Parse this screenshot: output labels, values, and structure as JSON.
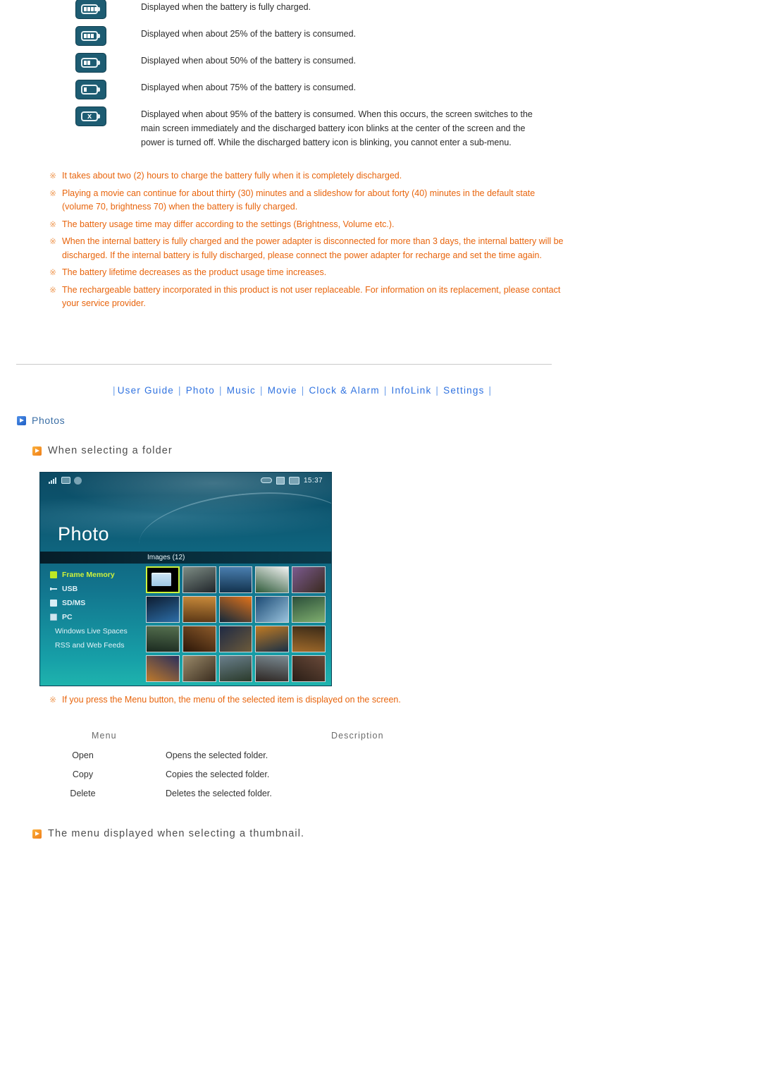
{
  "battery_table": {
    "rows": [
      {
        "icon": "battery-full-icon",
        "segments": 4,
        "desc": "Displayed when the battery is fully charged."
      },
      {
        "icon": "battery-75-icon",
        "segments": 3,
        "desc": "Displayed when about 25% of the battery is consumed."
      },
      {
        "icon": "battery-50-icon",
        "segments": 2,
        "desc": "Displayed when about 50% of the battery is consumed."
      },
      {
        "icon": "battery-25-icon",
        "segments": 1,
        "desc": "Displayed when about 75% of the battery is consumed."
      },
      {
        "icon": "battery-empty-x-icon",
        "segments": 0,
        "mark": "x",
        "desc": "Displayed when about 95% of the battery is consumed. When this occurs, the screen switches to the main screen immediately and the discharged battery icon blinks at the center of the screen and the power is turned off. While the discharged battery icon is blinking, you cannot enter a sub-menu."
      }
    ]
  },
  "notes": {
    "mark": "※",
    "items": [
      "It takes about two (2) hours to charge the battery fully when it is completely discharged.",
      "Playing a movie can continue for about thirty (30) minutes and a slideshow for about forty (40) minutes in the default state (volume 70, brightness 70) when the battery is fully charged.",
      "The battery usage time may differ according to the settings (Brightness, Volume etc.).",
      "When the internal battery is fully charged and the power adapter is disconnected for more than 3 days, the internal battery will be discharged. If the internal battery is fully discharged, please connect the power adapter for recharge and set the time again.",
      "The battery lifetime decreases as the product usage time increases.",
      "The rechargeable battery incorporated in this product is not user replaceable. For information on its replacement, please contact your service provider."
    ]
  },
  "nav": {
    "leading_sep": "|",
    "sep": "|",
    "items": [
      "User Guide",
      "Photo",
      "Music",
      "Movie",
      "Clock & Alarm",
      "InfoLink",
      "Settings"
    ],
    "link_color": "#2f72e0"
  },
  "sections": {
    "photos_title": "Photos",
    "sub_head_1": "When selecting a folder",
    "sub_head_2": "The menu displayed when selecting a thumbnail."
  },
  "device": {
    "status": {
      "signal_icon": "signal-bars-icon",
      "screen_icon": "screen-icon",
      "sound_icon": "sound-icon",
      "usb_icon": "usb-icon",
      "battery_icon": "battery-icon",
      "sd_icon": "sd-card-icon",
      "clock": "15:37"
    },
    "title": "Photo",
    "images_label": "Images (12)",
    "sidebar": [
      {
        "label": "Frame Memory",
        "icon": "green-square-icon",
        "selected": true
      },
      {
        "label": "USB",
        "icon": "usb-icon",
        "selected": false
      },
      {
        "label": "SD/MS",
        "icon": "sd-card-icon",
        "selected": false
      },
      {
        "label": "PC",
        "icon": "pc-icon",
        "selected": false
      },
      {
        "label": "Windows Live Spaces",
        "icon": "",
        "selected": false
      },
      {
        "label": "RSS and Web Feeds",
        "icon": "",
        "selected": false
      }
    ],
    "thumbnails": [
      {
        "kind": "folder",
        "selected": true,
        "color1": "#101010",
        "color2": "#2b2b2b"
      },
      {
        "kind": "photo",
        "selected": false,
        "color1": "#7d8c84",
        "color2": "#20252a"
      },
      {
        "kind": "photo",
        "selected": false,
        "color1": "#4a7fb0",
        "color2": "#12324d"
      },
      {
        "kind": "photo",
        "selected": false,
        "color1": "#f2f2f2",
        "color2": "#2f5b3a"
      },
      {
        "kind": "photo",
        "selected": false,
        "color1": "#7b5a8f",
        "color2": "#3a2a1e"
      },
      {
        "kind": "photo",
        "selected": false,
        "color1": "#0e1c30",
        "color2": "#2c6ea8"
      },
      {
        "kind": "photo",
        "selected": false,
        "color1": "#c98a3a",
        "color2": "#5a3716"
      },
      {
        "kind": "photo",
        "selected": false,
        "color1": "#e0721a",
        "color2": "#12283a"
      },
      {
        "kind": "photo",
        "selected": false,
        "color1": "#1b4a74",
        "color2": "#9ac3dd"
      },
      {
        "kind": "photo",
        "selected": false,
        "color1": "#2b4f3a",
        "color2": "#7fae6e"
      },
      {
        "kind": "photo",
        "selected": false,
        "color1": "#55704f",
        "color2": "#1b2a20"
      },
      {
        "kind": "photo",
        "selected": false,
        "color1": "#8c5a2a",
        "color2": "#2b1608"
      },
      {
        "kind": "photo",
        "selected": false,
        "color1": "#1f2a44",
        "color2": "#6c5a3a"
      },
      {
        "kind": "photo",
        "selected": false,
        "color1": "#c07a22",
        "color2": "#1a3046"
      },
      {
        "kind": "photo",
        "selected": false,
        "color1": "#3a2a18",
        "color2": "#a06a2a"
      },
      {
        "kind": "photo",
        "selected": false,
        "color1": "#2a2f5c",
        "color2": "#c07a2a"
      },
      {
        "kind": "photo",
        "selected": false,
        "color1": "#9a8a6a",
        "color2": "#3a2c1e"
      },
      {
        "kind": "photo",
        "selected": false,
        "color1": "#6a7f8c",
        "color2": "#2a3a2a"
      },
      {
        "kind": "photo",
        "selected": false,
        "color1": "#7a8a92",
        "color2": "#2e2622"
      },
      {
        "kind": "photo",
        "selected": false,
        "color1": "#6a4a3a",
        "color2": "#2a1e16"
      }
    ]
  },
  "device_note": "If you press the Menu button, the menu of the selected item is displayed on the screen.",
  "menu_table": {
    "headers": {
      "menu": "Menu",
      "description": "Description"
    },
    "rows": [
      {
        "menu": "Open",
        "description": "Opens the selected folder."
      },
      {
        "menu": "Copy",
        "description": "Copies the selected folder."
      },
      {
        "menu": "Delete",
        "description": "Deletes the selected folder."
      }
    ]
  }
}
